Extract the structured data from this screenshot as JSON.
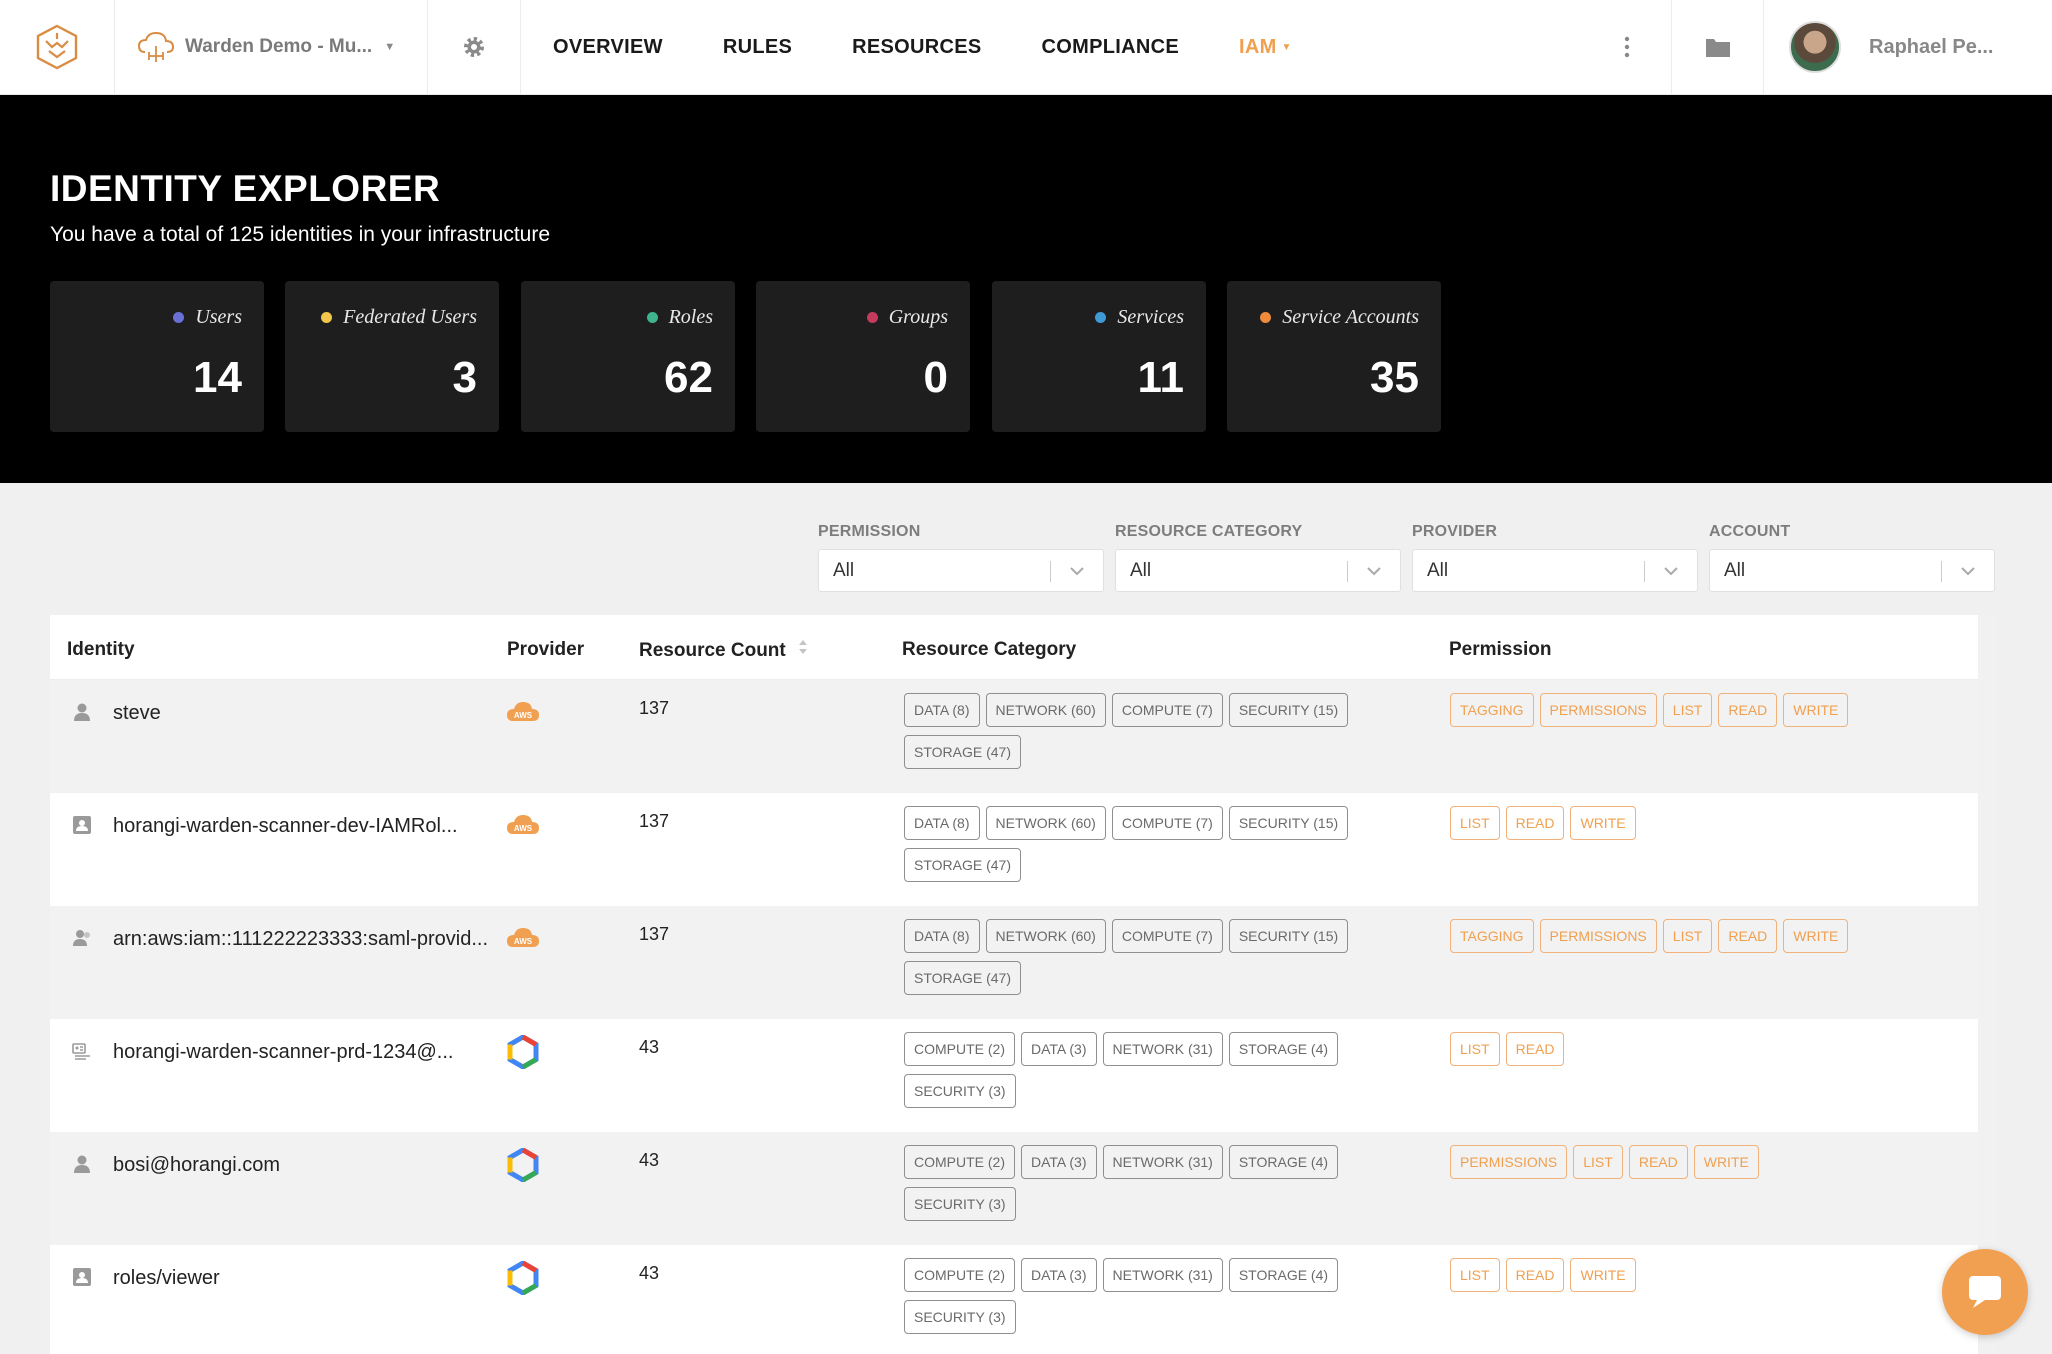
{
  "nav": {
    "project": "Warden Demo - Mu...",
    "links": [
      "OVERVIEW",
      "RULES",
      "RESOURCES",
      "COMPLIANCE"
    ],
    "active_link": "IAM",
    "user_name": "Raphael Pe..."
  },
  "hero": {
    "title": "IDENTITY EXPLORER",
    "subtitle": "You have a total of 125 identities in your infrastructure",
    "stats": [
      {
        "label": "Users",
        "value": "14",
        "dot_color": "#6a6fd6"
      },
      {
        "label": "Federated Users",
        "value": "3",
        "dot_color": "#f2c64a"
      },
      {
        "label": "Roles",
        "value": "62",
        "dot_color": "#3fb38e"
      },
      {
        "label": "Groups",
        "value": "0",
        "dot_color": "#c43b5e"
      },
      {
        "label": "Services",
        "value": "11",
        "dot_color": "#3f9ad6"
      },
      {
        "label": "Service Accounts",
        "value": "35",
        "dot_color": "#f08a3c"
      }
    ]
  },
  "filters": [
    {
      "label": "PERMISSION",
      "value": "All"
    },
    {
      "label": "RESOURCE CATEGORY",
      "value": "All"
    },
    {
      "label": "PROVIDER",
      "value": "All"
    },
    {
      "label": "ACCOUNT",
      "value": "All"
    }
  ],
  "table": {
    "columns": [
      "Identity",
      "Provider",
      "Resource Count",
      "Resource Category",
      "Permission"
    ],
    "rows": [
      {
        "identity": "steve",
        "identity_icon": "user-icon",
        "provider": "aws-icon",
        "count": "137",
        "categories": [
          "DATA (8)",
          "NETWORK (60)",
          "COMPUTE (7)",
          "SECURITY (15)",
          "STORAGE (47)"
        ],
        "permissions": [
          "TAGGING",
          "PERMISSIONS",
          "LIST",
          "READ",
          "WRITE"
        ]
      },
      {
        "identity": "horangi-warden-scanner-dev-IAMRol...",
        "identity_icon": "role-badge-icon",
        "provider": "aws-icon",
        "count": "137",
        "categories": [
          "DATA (8)",
          "NETWORK (60)",
          "COMPUTE (7)",
          "SECURITY (15)",
          "STORAGE (47)"
        ],
        "permissions": [
          "LIST",
          "READ",
          "WRITE"
        ]
      },
      {
        "identity": "arn:aws:iam::111222223333:saml-provid...",
        "identity_icon": "federated-user-icon",
        "provider": "aws-icon",
        "count": "137",
        "categories": [
          "DATA (8)",
          "NETWORK (60)",
          "COMPUTE (7)",
          "SECURITY (15)",
          "STORAGE (47)"
        ],
        "permissions": [
          "TAGGING",
          "PERMISSIONS",
          "LIST",
          "READ",
          "WRITE"
        ]
      },
      {
        "identity": "horangi-warden-scanner-prd-1234@...",
        "identity_icon": "service-account-icon",
        "provider": "gcp-icon",
        "count": "43",
        "categories": [
          "COMPUTE (2)",
          "DATA (3)",
          "NETWORK (31)",
          "STORAGE (4)",
          "SECURITY (3)"
        ],
        "permissions": [
          "LIST",
          "READ"
        ]
      },
      {
        "identity": "bosi@horangi.com",
        "identity_icon": "user-icon",
        "provider": "gcp-icon",
        "count": "43",
        "categories": [
          "COMPUTE (2)",
          "DATA (3)",
          "NETWORK (31)",
          "STORAGE (4)",
          "SECURITY (3)"
        ],
        "permissions": [
          "PERMISSIONS",
          "LIST",
          "READ",
          "WRITE"
        ]
      },
      {
        "identity": "roles/viewer",
        "identity_icon": "role-badge-icon",
        "provider": "gcp-icon",
        "count": "43",
        "categories": [
          "COMPUTE (2)",
          "DATA (3)",
          "NETWORK (31)",
          "STORAGE (4)",
          "SECURITY (3)"
        ],
        "permissions": [
          "LIST",
          "READ",
          "WRITE"
        ]
      }
    ]
  },
  "colors": {
    "accent": "#f0a050",
    "hero_bg": "#000000",
    "card_bg": "#1e1e1e"
  }
}
